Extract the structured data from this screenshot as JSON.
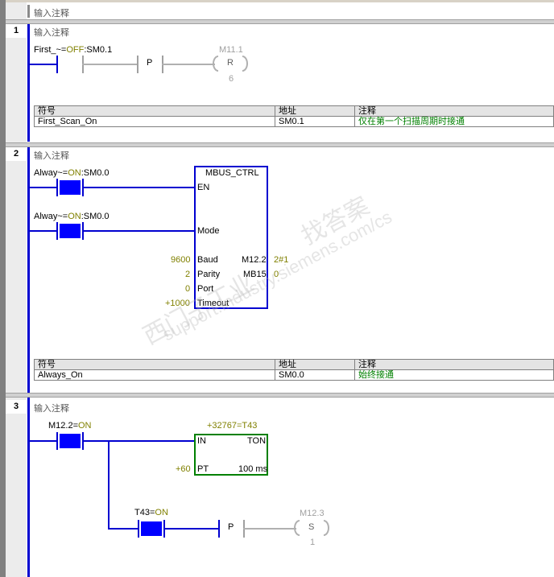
{
  "header_comment": "输入注释",
  "networks": [
    {
      "number": "1",
      "comment": "输入注释",
      "contact_label": "First_~=OFF:SM0.1",
      "contact_label_name": "First_~=",
      "contact_label_state": "OFF",
      "contact_label_addr": ":SM0.1",
      "edge_label": "P",
      "coil_address": "M11.1",
      "coil_type": "R",
      "coil_count": "6",
      "symbol_table": {
        "headers": [
          "符号",
          "地址",
          "注释"
        ],
        "rows": [
          [
            "First_Scan_On",
            "SM0.1",
            "仅在第一个扫描周期时接通"
          ]
        ]
      }
    },
    {
      "number": "2",
      "comment": "输入注释",
      "contact1_name": "Alway~=",
      "contact1_state": "ON",
      "contact1_addr": ":SM0.0",
      "contact2_name": "Alway~=",
      "contact2_state": "ON",
      "contact2_addr": ":SM0.0",
      "block_title": "MBUS_CTRL",
      "pins_left": [
        "EN",
        "Mode",
        "Baud",
        "Parity",
        "Port",
        "Timeout"
      ],
      "pins_right": [
        "M12.2",
        "MB15"
      ],
      "values_left": [
        "9600",
        "2",
        "0",
        "+1000"
      ],
      "values_right": [
        "2#1",
        "0"
      ],
      "symbol_table": {
        "headers": [
          "符号",
          "地址",
          "注释"
        ],
        "rows": [
          [
            "Always_On",
            "SM0.0",
            "始终接通"
          ]
        ]
      }
    },
    {
      "number": "3",
      "comment": "输入注释",
      "contact1_name": "M12.2=",
      "contact1_state": "ON",
      "timer_label": "+32767=T43",
      "timer_pin_in": "IN",
      "timer_type": "TON",
      "timer_pin_pt": "PT",
      "timer_base": "100 ms",
      "timer_pt_value": "+60",
      "contact2_name": "T43=",
      "contact2_state": "ON",
      "edge_label": "P",
      "coil_address": "M12.3",
      "coil_type": "S",
      "coil_count": "1"
    }
  ],
  "watermark": [
    "西门子工业",
    "找答案",
    "support.industry.siemens.com/cs"
  ],
  "colors": {
    "power_rail": "#0000d0",
    "contact_on": "#0000ff",
    "value_text": "#808000",
    "comment_green": "#008000"
  }
}
